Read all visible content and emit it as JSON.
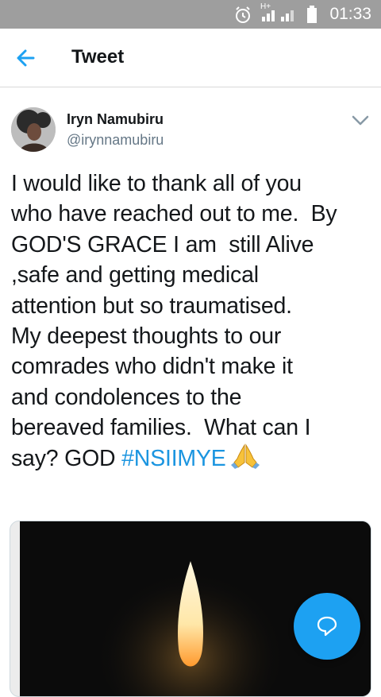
{
  "status_bar": {
    "time": "01:33",
    "network_label": "H+"
  },
  "header": {
    "title": "Tweet"
  },
  "tweet": {
    "author_name": "Iryn Namubiru",
    "author_handle": "@irynnamubiru",
    "lines": [
      "I would like to thank all of you",
      "who have reached out to me.  By",
      "GOD'S GRACE I am  still Alive",
      ",safe and getting medical",
      "attention but so traumatised.",
      "My deepest thoughts to our",
      "comrades who didn't make it",
      "and condolences to the",
      "bereaved families.  What can I",
      "say? GOD "
    ],
    "hashtag": "#NSIIMYE",
    "emoji": "🙏"
  },
  "colors": {
    "accent": "#1da1f2",
    "hashtag": "#1b95e0",
    "status_bar": "#9e9e9e"
  },
  "icons": {
    "back": "arrow-left-icon",
    "more": "chevron-down-icon",
    "compose": "reply-bubble-icon",
    "alarm": "alarm-clock-icon",
    "signal": "signal-icon",
    "battery": "battery-icon"
  }
}
